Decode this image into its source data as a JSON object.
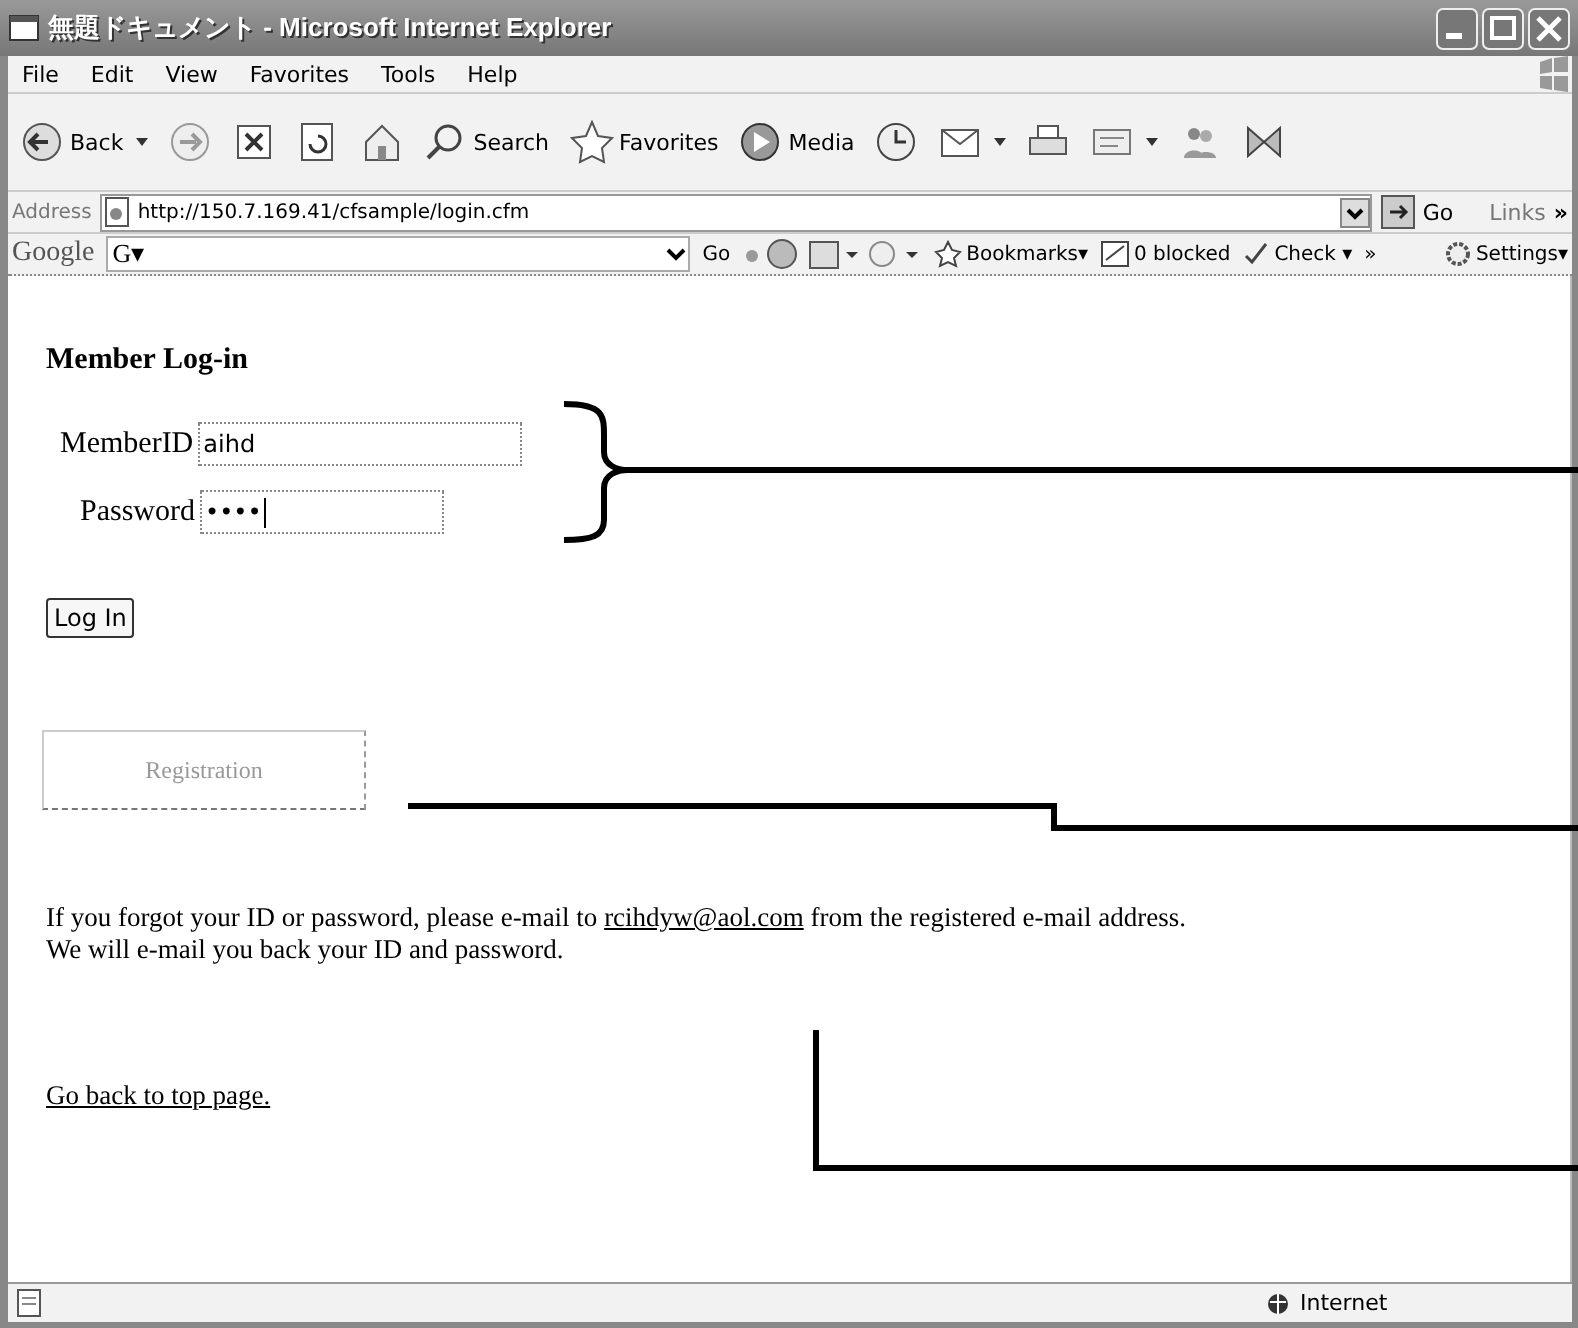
{
  "window": {
    "title": "無題ドキュメント - Microsoft Internet Explorer"
  },
  "menu": [
    "File",
    "Edit",
    "View",
    "Favorites",
    "Tools",
    "Help"
  ],
  "toolbar": [
    {
      "kind": "back",
      "label": "Back"
    },
    {
      "kind": "forward"
    },
    {
      "kind": "stop"
    },
    {
      "kind": "refresh"
    },
    {
      "kind": "home"
    },
    {
      "kind": "search",
      "label": "Search"
    },
    {
      "kind": "favorites",
      "label": "Favorites"
    },
    {
      "kind": "media",
      "label": "Media"
    },
    {
      "kind": "history"
    },
    {
      "kind": "mail"
    },
    {
      "kind": "print"
    },
    {
      "kind": "edit"
    },
    {
      "kind": "messenger"
    },
    {
      "kind": "tool"
    }
  ],
  "address": {
    "label": "Address",
    "url": "http://150.7.169.41/cfsample/login.cfm",
    "go": "Go",
    "links": "Links",
    "more": "»"
  },
  "google_bar": {
    "logo": "Google",
    "search_menu": "G▾",
    "go": "Go",
    "bookmarks": "Bookmarks▾",
    "blocked": "0 blocked",
    "check": "Check ▾",
    "more": "»",
    "settings": "Settings▾"
  },
  "page": {
    "heading": "Member Log-in",
    "fields": [
      {
        "label": "MemberID",
        "value": "aihd",
        "kind": "text"
      },
      {
        "label": "Password",
        "value": "••••",
        "kind": "password"
      }
    ],
    "login_button": "Log In",
    "registration_button": "Registration",
    "help_before": "If you forgot your ID or password, please e-mail to ",
    "help_link": "rcihdyw@aol.com",
    "help_after": " from the registered e-mail address.",
    "help_line2": "We will e-mail you back your ID and password.",
    "back_link": "Go back to top page."
  },
  "status_bar": {
    "zone": "Internet"
  }
}
